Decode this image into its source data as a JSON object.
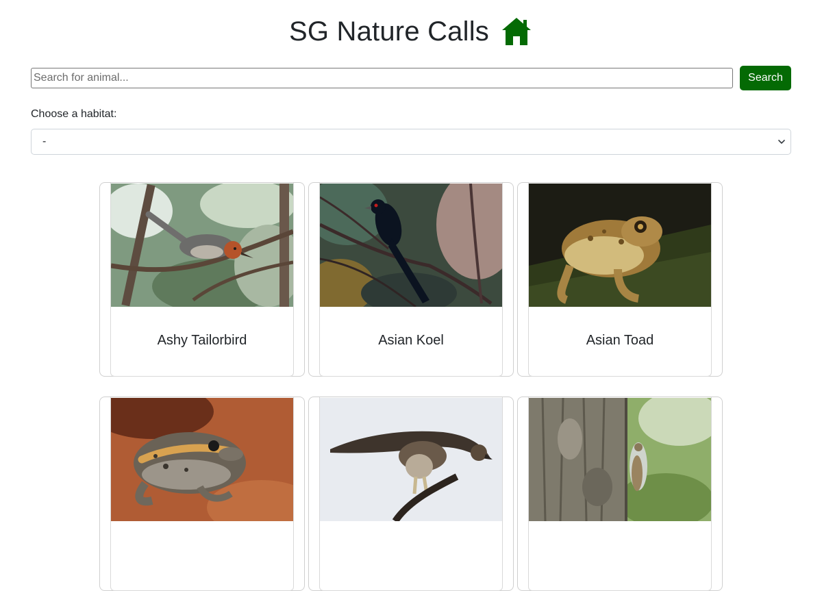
{
  "header": {
    "title": "SG Nature Calls",
    "home_icon": "house-icon",
    "accent_color": "#046a04"
  },
  "search": {
    "placeholder": "Search for animal...",
    "value": "",
    "button_label": "Search"
  },
  "habitat": {
    "label": "Choose a habitat:",
    "selected": "-"
  },
  "animals": [
    {
      "name": "Ashy Tailorbird",
      "image": "bird-on-branch"
    },
    {
      "name": "Asian Koel",
      "image": "black-bird-on-branch"
    },
    {
      "name": "Asian Toad",
      "image": "toad-on-mossy-log"
    },
    {
      "name": "",
      "image": "frog-on-red-soil"
    },
    {
      "name": "",
      "image": "hawk-eagle-on-branch"
    },
    {
      "name": "",
      "image": "cicada-on-tree-trunk"
    }
  ]
}
